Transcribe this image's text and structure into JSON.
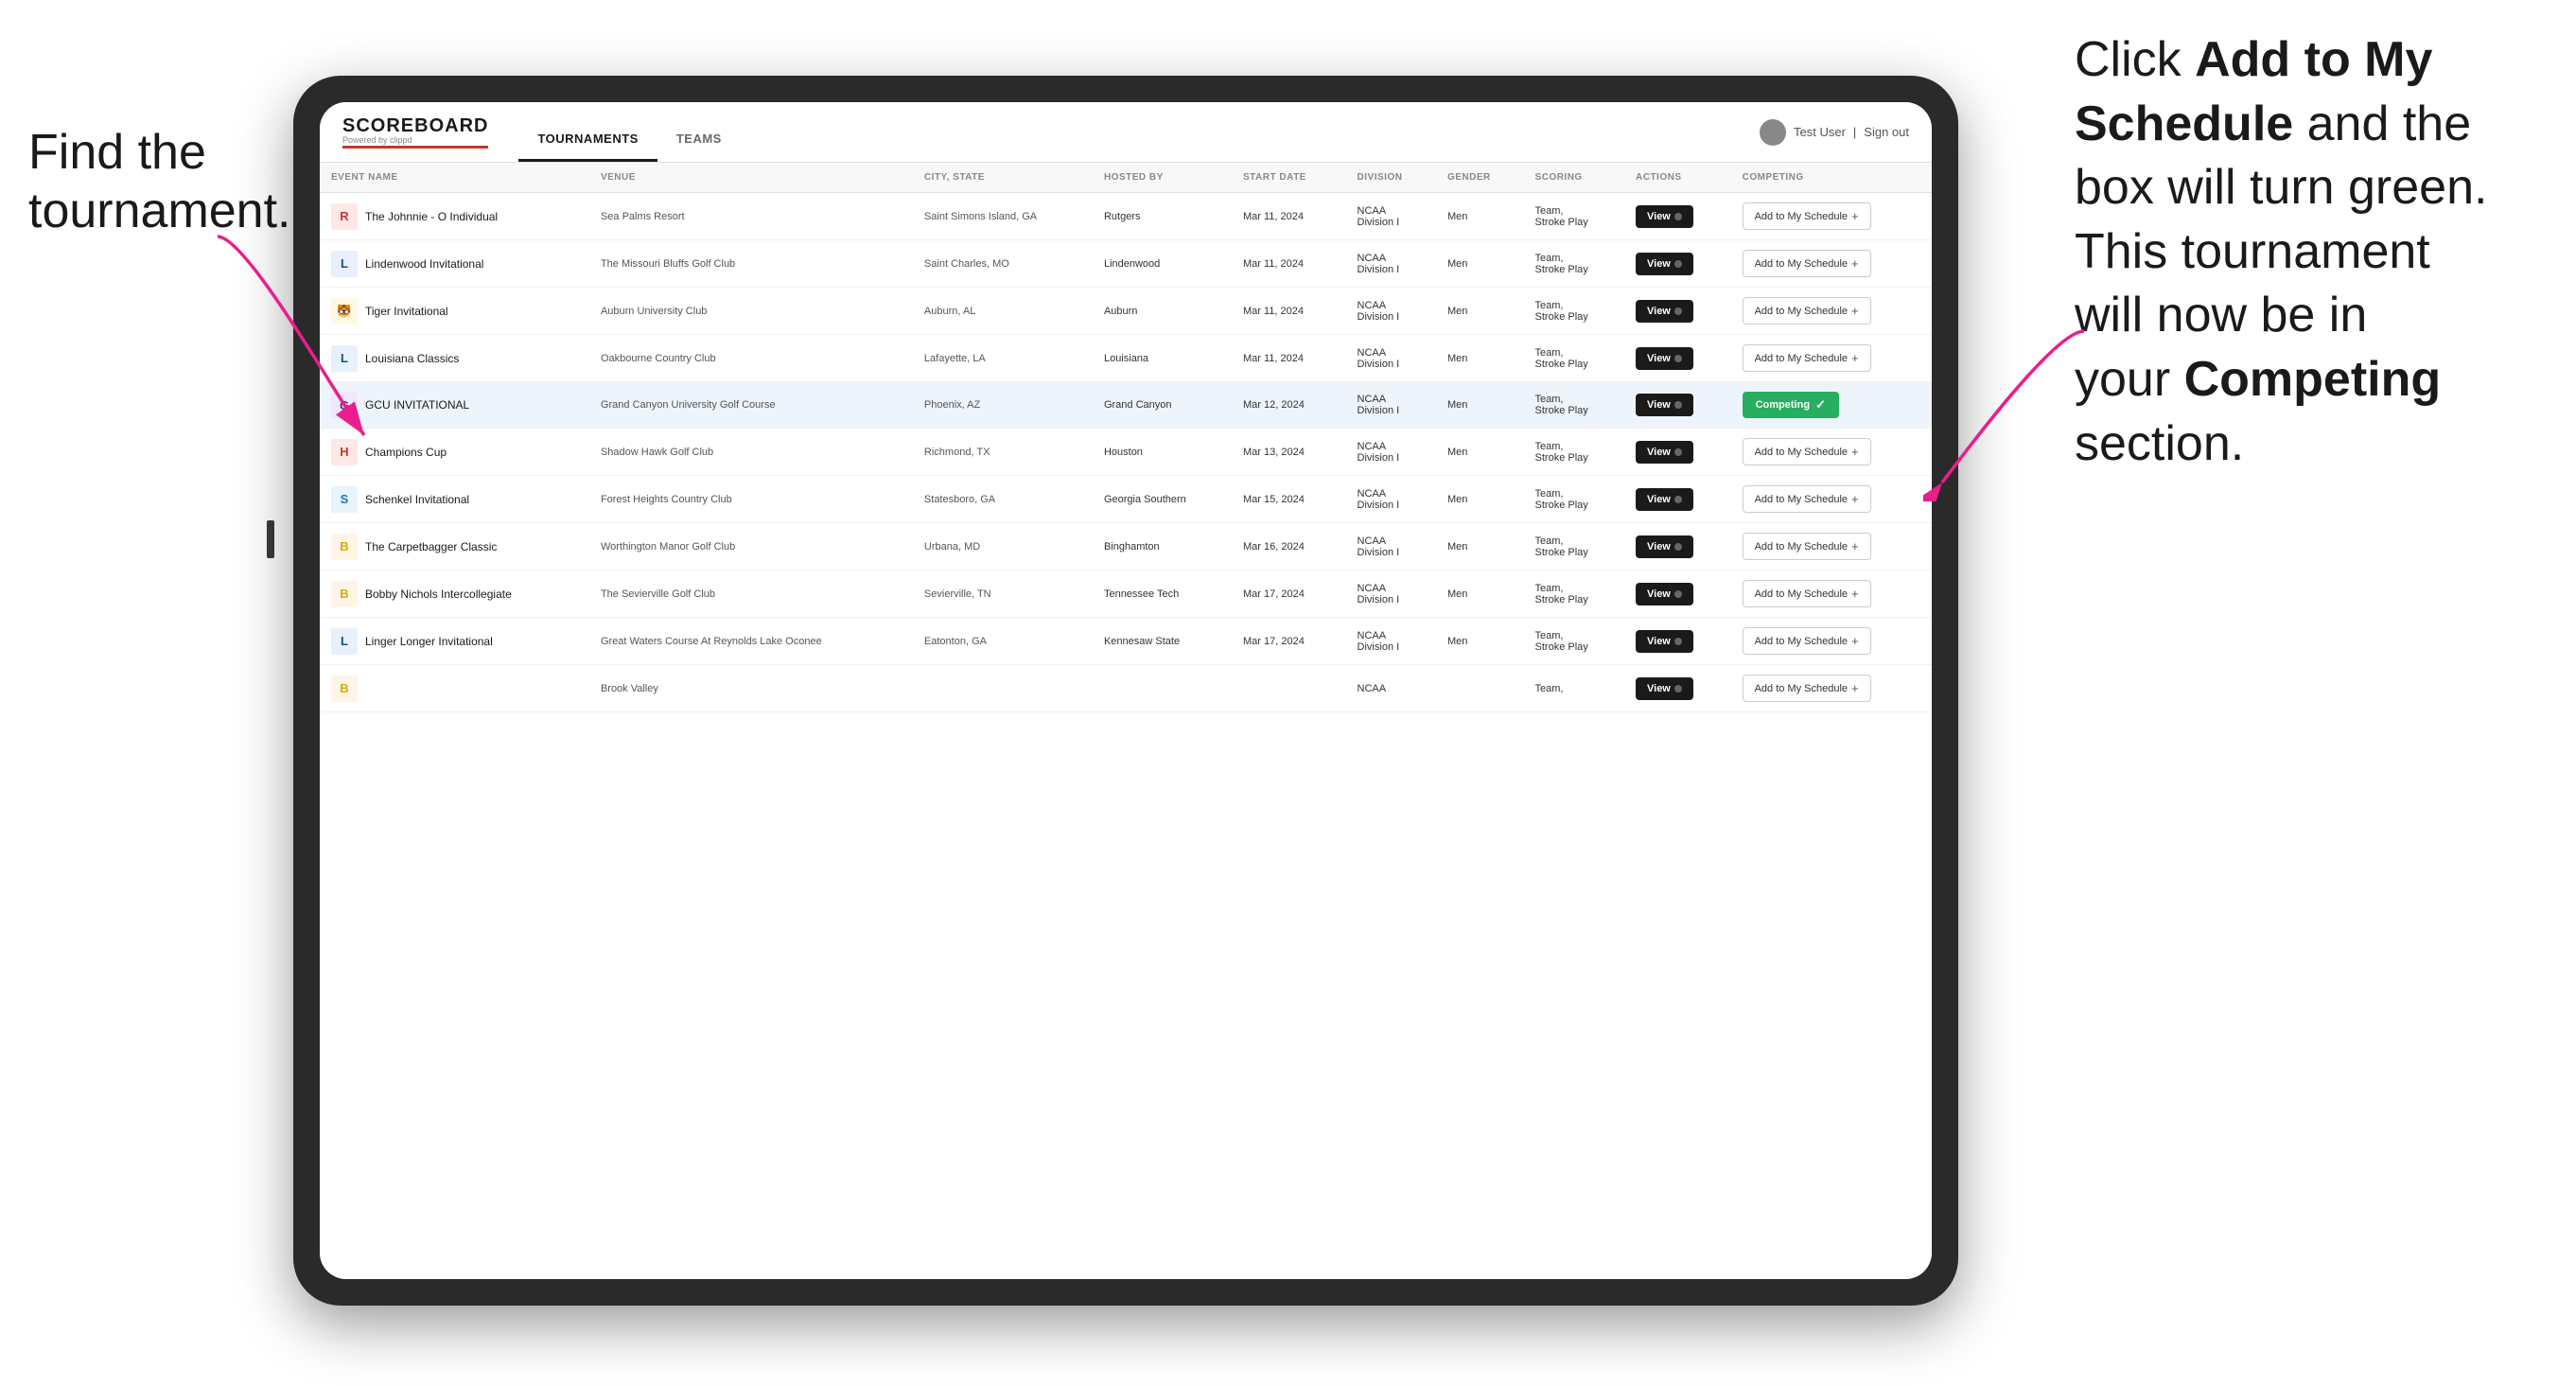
{
  "annotations": {
    "left": "Find the\ntournament.",
    "right_line1": "Click ",
    "right_bold1": "Add to My\nSchedule",
    "right_line2": " and the\nbox will turn green.\nThis tournament\nwill now be in\nyour ",
    "right_bold2": "Competing",
    "right_line3": "\nsection."
  },
  "app": {
    "logo": "SCOREBOARD",
    "logo_sub": "Powered by clippd",
    "nav": [
      "TOURNAMENTS",
      "TEAMS"
    ],
    "active_nav": "TOURNAMENTS",
    "user": "Test User",
    "sign_out": "Sign out"
  },
  "table": {
    "columns": [
      "EVENT NAME",
      "VENUE",
      "CITY, STATE",
      "HOSTED BY",
      "START DATE",
      "DIVISION",
      "GENDER",
      "SCORING",
      "ACTIONS",
      "COMPETING"
    ],
    "rows": [
      {
        "icon": "R",
        "icon_color": "#c0392b",
        "name": "The Johnnie - O Individual",
        "venue": "Sea Palms Resort",
        "city_state": "Saint Simons Island, GA",
        "hosted_by": "Rutgers",
        "start_date": "Mar 11, 2024",
        "division": "NCAA Division I",
        "gender": "Men",
        "scoring": "Team, Stroke Play",
        "status": "add",
        "highlighted": false
      },
      {
        "icon": "L",
        "icon_color": "#1a5276",
        "name": "Lindenwood Invitational",
        "venue": "The Missouri Bluffs Golf Club",
        "city_state": "Saint Charles, MO",
        "hosted_by": "Lindenwood",
        "start_date": "Mar 11, 2024",
        "division": "NCAA Division I",
        "gender": "Men",
        "scoring": "Team, Stroke Play",
        "status": "add",
        "highlighted": false
      },
      {
        "icon": "T",
        "icon_color": "#f39c12",
        "name": "Tiger Invitational",
        "venue": "Auburn University Club",
        "city_state": "Auburn, AL",
        "hosted_by": "Auburn",
        "start_date": "Mar 11, 2024",
        "division": "NCAA Division I",
        "gender": "Men",
        "scoring": "Team, Stroke Play",
        "status": "add",
        "highlighted": false
      },
      {
        "icon": "L",
        "icon_color": "#8e1a2e",
        "name": "Louisiana Classics",
        "venue": "Oakbourne Country Club",
        "city_state": "Lafayette, LA",
        "hosted_by": "Louisiana",
        "start_date": "Mar 11, 2024",
        "division": "NCAA Division I",
        "gender": "Men",
        "scoring": "Team, Stroke Play",
        "status": "add",
        "highlighted": false
      },
      {
        "icon": "G",
        "icon_color": "#5b2d8e",
        "name": "GCU INVITATIONAL",
        "venue": "Grand Canyon University Golf Course",
        "city_state": "Phoenix, AZ",
        "hosted_by": "Grand Canyon",
        "start_date": "Mar 12, 2024",
        "division": "NCAA Division I",
        "gender": "Men",
        "scoring": "Team, Stroke Play",
        "status": "competing",
        "highlighted": true
      },
      {
        "icon": "H",
        "icon_color": "#c0392b",
        "name": "Champions Cup",
        "venue": "Shadow Hawk Golf Club",
        "city_state": "Richmond, TX",
        "hosted_by": "Houston",
        "start_date": "Mar 13, 2024",
        "division": "NCAA Division I",
        "gender": "Men",
        "scoring": "Team, Stroke Play",
        "status": "add",
        "highlighted": false
      },
      {
        "icon": "S",
        "icon_color": "#2874a6",
        "name": "Schenkel Invitational",
        "venue": "Forest Heights Country Club",
        "city_state": "Statesboro, GA",
        "hosted_by": "Georgia Southern",
        "start_date": "Mar 15, 2024",
        "division": "NCAA Division I",
        "gender": "Men",
        "scoring": "Team, Stroke Play",
        "status": "add",
        "highlighted": false
      },
      {
        "icon": "B",
        "icon_color": "#1a5276",
        "name": "The Carpetbagger Classic",
        "venue": "Worthington Manor Golf Club",
        "city_state": "Urbana, MD",
        "hosted_by": "Binghamton",
        "start_date": "Mar 16, 2024",
        "division": "NCAA Division I",
        "gender": "Men",
        "scoring": "Team, Stroke Play",
        "status": "add",
        "highlighted": false
      },
      {
        "icon": "B",
        "icon_color": "#d4ac0d",
        "name": "Bobby Nichols Intercollegiate",
        "venue": "The Sevierville Golf Club",
        "city_state": "Sevierville, TN",
        "hosted_by": "Tennessee Tech",
        "start_date": "Mar 17, 2024",
        "division": "NCAA Division I",
        "gender": "Men",
        "scoring": "Team, Stroke Play",
        "status": "add",
        "highlighted": false
      },
      {
        "icon": "L",
        "icon_color": "#c0392b",
        "name": "Linger Longer Invitational",
        "venue": "Great Waters Course At Reynolds Lake Oconee",
        "city_state": "Eatonton, GA",
        "hosted_by": "Kennesaw State",
        "start_date": "Mar 17, 2024",
        "division": "NCAA Division I",
        "gender": "Men",
        "scoring": "Team, Stroke Play",
        "status": "add",
        "highlighted": false
      },
      {
        "icon": "B",
        "icon_color": "#555",
        "name": "",
        "venue": "Brook Valley",
        "city_state": "",
        "hosted_by": "",
        "start_date": "",
        "division": "NCAA",
        "gender": "",
        "scoring": "Team,",
        "status": "add",
        "highlighted": false
      }
    ],
    "buttons": {
      "view": "View",
      "add_to_schedule": "Add to My Schedule",
      "competing": "Competing"
    }
  }
}
